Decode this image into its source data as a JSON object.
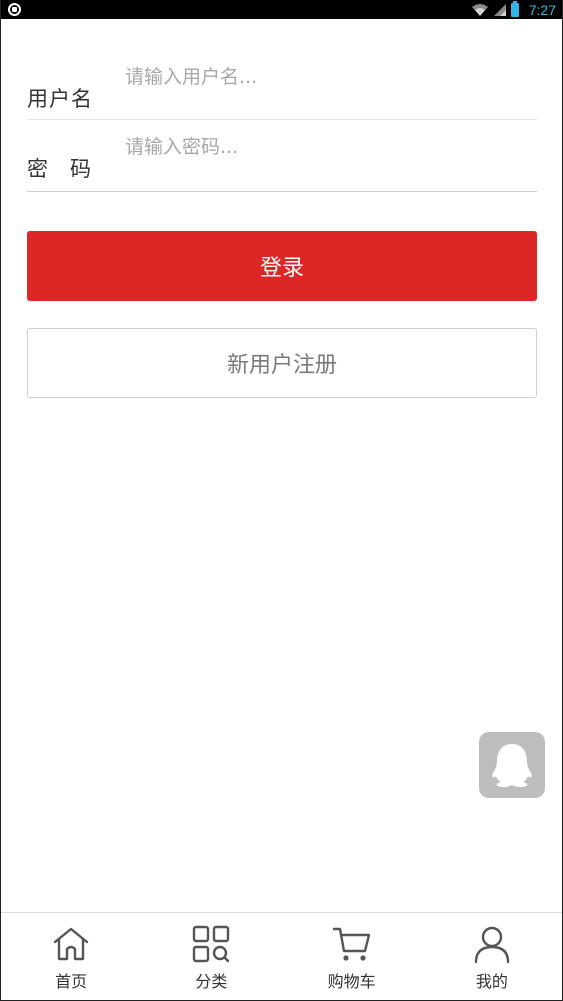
{
  "status_bar": {
    "time": "7:27",
    "icons": [
      "shield-icon",
      "wifi-icon",
      "signal-icon",
      "battery-icon"
    ]
  },
  "login_form": {
    "username_label": "用户名",
    "username_placeholder": "请输入用户名...",
    "username_value": "",
    "password_label_1": "密",
    "password_label_2": "码",
    "password_placeholder": "请输入密码...",
    "password_value": "",
    "login_button": "登录",
    "register_button": "新用户注册"
  },
  "floating": {
    "icon": "qq-icon"
  },
  "tab_bar": {
    "items": [
      {
        "label": "首页",
        "icon": "home-icon"
      },
      {
        "label": "分类",
        "icon": "category-icon"
      },
      {
        "label": "购物车",
        "icon": "cart-icon"
      },
      {
        "label": "我的",
        "icon": "user-icon"
      }
    ]
  },
  "colors": {
    "accent": "#dd2727",
    "status_text": "#33b5e5",
    "placeholder": "#a8a8a8",
    "floating_bg": "#bdbdbd"
  }
}
